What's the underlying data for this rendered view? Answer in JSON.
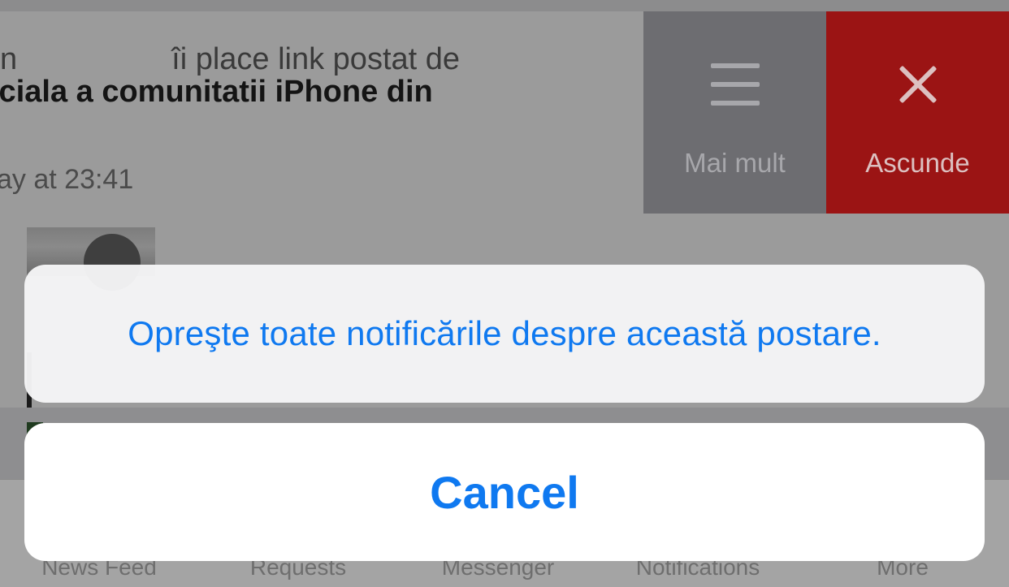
{
  "notification": {
    "text_prefix": "n",
    "text_line1": "îi place link postat de",
    "text_line2": "iciala a comunitatii iPhone din",
    "time": "ay at 23:41"
  },
  "swipe_actions": {
    "more_label": "Mai mult",
    "more_icon": "menu-icon",
    "hide_label": "Ascunde",
    "hide_icon": "close-icon",
    "more_color": "#6d6d71",
    "hide_color": "#9b1414"
  },
  "tabbar": {
    "tabs": [
      "News Feed",
      "Requests",
      "Messenger",
      "Notifications",
      "More"
    ]
  },
  "action_sheet": {
    "option_label": "Opreşte toate notificările despre această postare.",
    "cancel_label": "Cancel",
    "accent_color": "#0f79f0"
  }
}
